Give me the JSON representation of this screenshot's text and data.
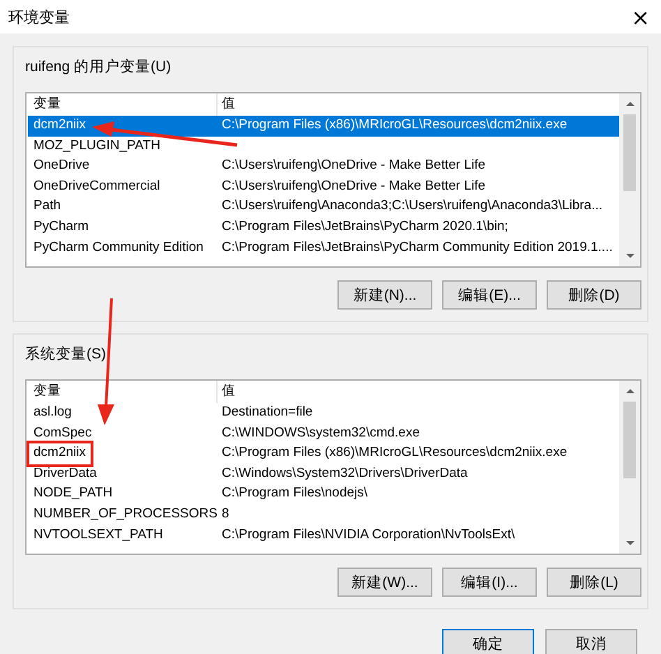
{
  "window": {
    "title": "环境变量",
    "close": "×"
  },
  "sections": [
    {
      "label": "ruifeng 的用户变量(U)",
      "columns": [
        "变量",
        "值"
      ],
      "rows": [
        {
          "name": "dcm2niix",
          "value": "C:\\Program Files (x86)\\MRIcroGL\\Resources\\dcm2niix.exe",
          "selected": true,
          "highlighted": false
        },
        {
          "name": "MOZ_PLUGIN_PATH",
          "value": "",
          "selected": false,
          "highlighted": false
        },
        {
          "name": "OneDrive",
          "value": "C:\\Users\\ruifeng\\OneDrive - Make Better Life",
          "selected": false,
          "highlighted": false
        },
        {
          "name": "OneDriveCommercial",
          "value": "C:\\Users\\ruifeng\\OneDrive - Make Better Life",
          "selected": false,
          "highlighted": false
        },
        {
          "name": "Path",
          "value": "C:\\Users\\ruifeng\\Anaconda3;C:\\Users\\ruifeng\\Anaconda3\\Libra...",
          "selected": false,
          "highlighted": false
        },
        {
          "name": "PyCharm",
          "value": "C:\\Program Files\\JetBrains\\PyCharm 2020.1\\bin;",
          "selected": false,
          "highlighted": false
        },
        {
          "name": "PyCharm Community Edition",
          "value": "C:\\Program Files\\JetBrains\\PyCharm Community Edition 2019.1....",
          "selected": false,
          "highlighted": false
        }
      ],
      "buttons": [
        "新建(N)...",
        "编辑(E)...",
        "删除(D)"
      ]
    },
    {
      "label": "系统变量(S)",
      "columns": [
        "变量",
        "值"
      ],
      "rows": [
        {
          "name": "asl.log",
          "value": "Destination=file",
          "selected": false,
          "highlighted": false
        },
        {
          "name": "ComSpec",
          "value": "C:\\WINDOWS\\system32\\cmd.exe",
          "selected": false,
          "highlighted": false
        },
        {
          "name": "dcm2niix",
          "value": "C:\\Program Files (x86)\\MRIcroGL\\Resources\\dcm2niix.exe",
          "selected": false,
          "highlighted": true
        },
        {
          "name": "DriverData",
          "value": "C:\\Windows\\System32\\Drivers\\DriverData",
          "selected": false,
          "highlighted": false
        },
        {
          "name": "NODE_PATH",
          "value": "C:\\Program Files\\nodejs\\",
          "selected": false,
          "highlighted": false
        },
        {
          "name": "NUMBER_OF_PROCESSORS",
          "value": "8",
          "selected": false,
          "highlighted": false
        },
        {
          "name": "NVTOOLSEXT_PATH",
          "value": "C:\\Program Files\\NVIDIA Corporation\\NvToolsExt\\",
          "selected": false,
          "highlighted": false
        }
      ],
      "buttons": [
        "新建(W)...",
        "编辑(I)...",
        "删除(L)"
      ]
    }
  ],
  "footer_buttons": [
    {
      "label": "确定",
      "default": true
    },
    {
      "label": "取消",
      "default": false
    }
  ]
}
